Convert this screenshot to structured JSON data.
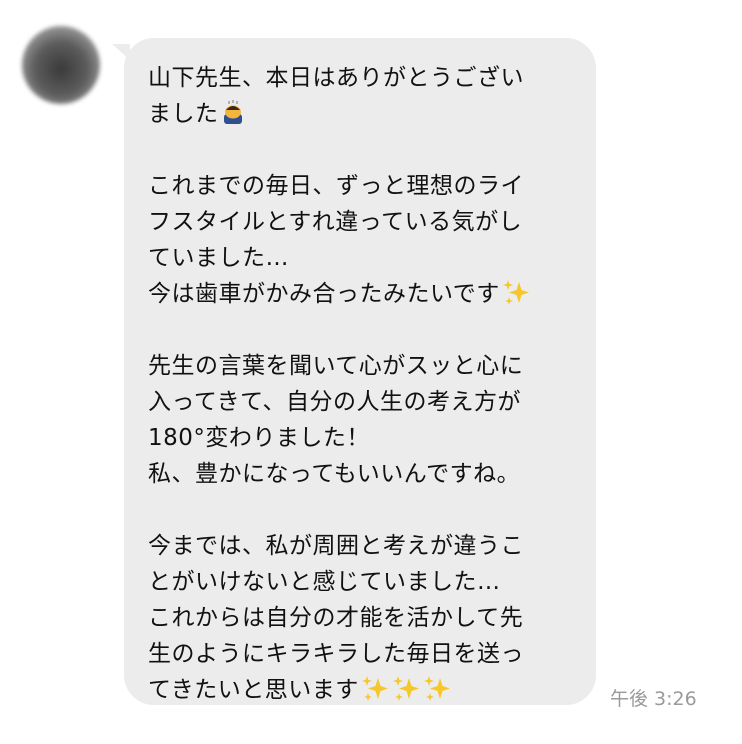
{
  "message": {
    "lines": [
      "山下先生、本日はありがとうござい",
      "ました",
      "",
      "これまでの毎日、ずっと理想のライ",
      "フスタイルとすれ違っている気がし",
      "ていました…",
      "今は歯車がかみ合ったみたいです",
      "",
      "先生の言葉を聞いて心がスッと心に",
      "入ってきて、自分の人生の考え方が",
      "180°変わりました！",
      "私、豊かになってもいいんですね。",
      "",
      "今までは、私が周囲と考えが違うこ",
      "とがいけないと感じていました…",
      "これからは自分の才能を活かして先",
      "生のようにキラキラした毎日を送っ",
      "てきたいと思います"
    ],
    "emoji": {
      "line2": "bowing-person-emoji",
      "line7": "sparkles-emoji",
      "line18": "sparkles-emoji-x3"
    },
    "bubble_color": "#ececec"
  },
  "timestamp": "午後 3:26"
}
